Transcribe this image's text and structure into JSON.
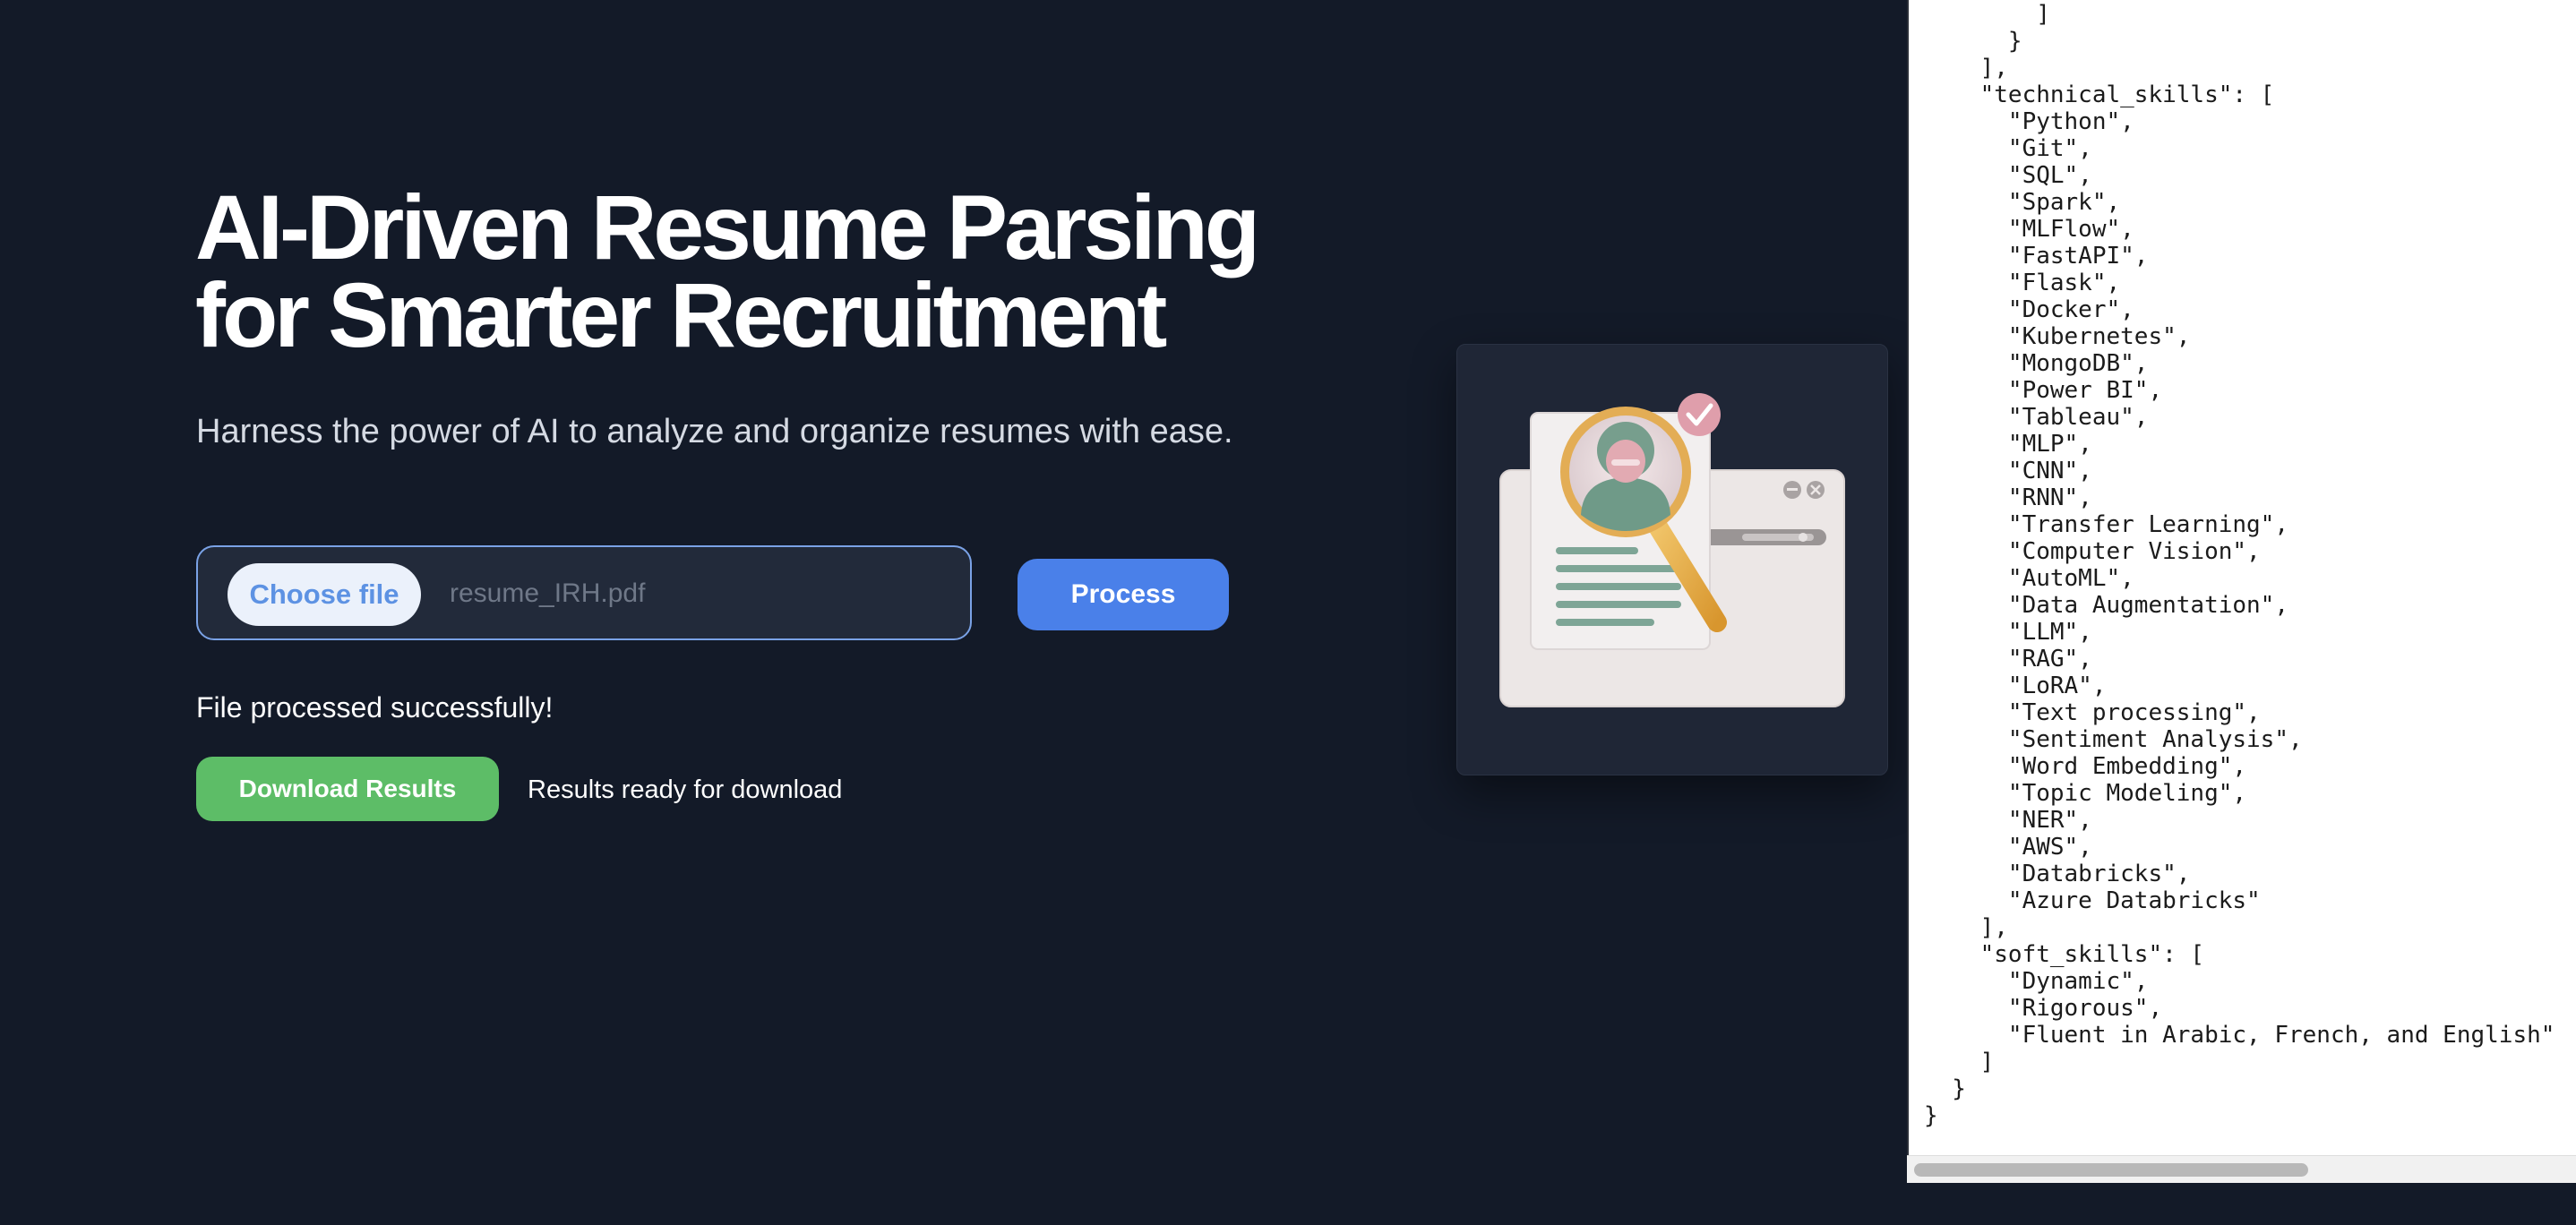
{
  "hero": {
    "title_line1": "AI-Driven Resume Parsing",
    "title_line2": "for Smarter Recruitment",
    "subtitle": "Harness the power of AI to analyze and organize resumes with ease."
  },
  "upload": {
    "choose_label": "Choose file",
    "file_name": "resume_IRH.pdf",
    "process_label": "Process"
  },
  "status": {
    "message": "File processed successfully!",
    "download_label": "Download Results",
    "ready_message": "Results ready for download"
  },
  "illustration": {
    "icon": "resume-search-illustration"
  },
  "json_output": {
    "text": "          \"\n        ]\n      }\n    ],\n    \"technical_skills\": [\n      \"Python\",\n      \"Git\",\n      \"SQL\",\n      \"Spark\",\n      \"MLFlow\",\n      \"FastAPI\",\n      \"Flask\",\n      \"Docker\",\n      \"Kubernetes\",\n      \"MongoDB\",\n      \"Power BI\",\n      \"Tableau\",\n      \"MLP\",\n      \"CNN\",\n      \"RNN\",\n      \"Transfer Learning\",\n      \"Computer Vision\",\n      \"AutoML\",\n      \"Data Augmentation\",\n      \"LLM\",\n      \"RAG\",\n      \"LoRA\",\n      \"Text processing\",\n      \"Sentiment Analysis\",\n      \"Word Embedding\",\n      \"Topic Modeling\",\n      \"NER\",\n      \"AWS\",\n      \"Databricks\",\n      \"Azure Databricks\"\n    ],\n    \"soft_skills\": [\n      \"Dynamic\",\n      \"Rigorous\",\n      \"Fluent in Arabic, French, and English\"\n    ]\n  }\n}"
  },
  "colors": {
    "background": "#131a28",
    "accent_blue": "#4a80e9",
    "success_green": "#5dbd67",
    "file_border": "#7aa2e6"
  }
}
